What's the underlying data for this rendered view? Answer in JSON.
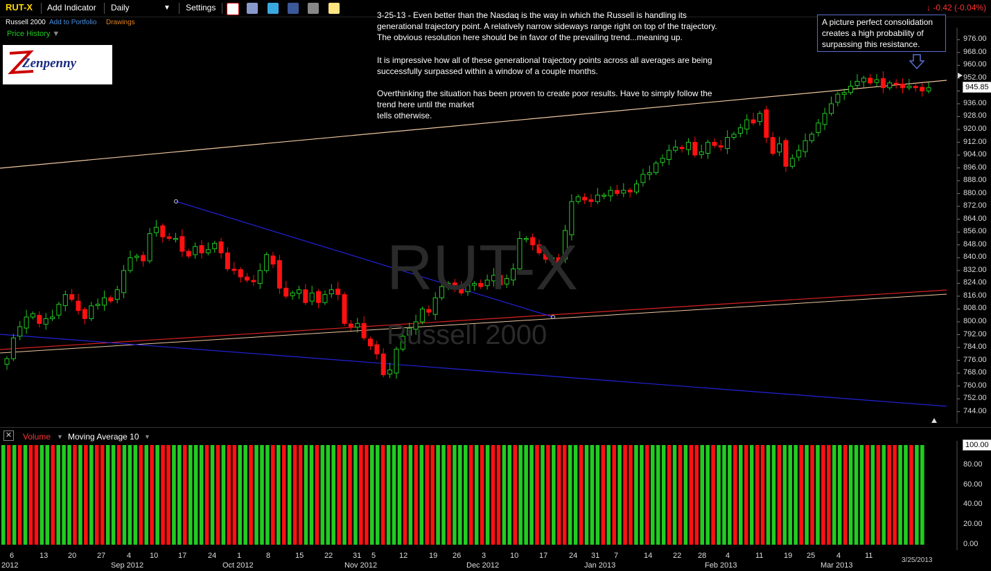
{
  "toolbar": {
    "ticker": "RUT-X",
    "add_indicator": "Add Indicator",
    "period": "Daily",
    "settings": "Settings",
    "change": "-0.42 (-0.04%)",
    "name": "Russell 2000",
    "add_to_portfolio": "Add to Portfolio",
    "drawings": "Drawings",
    "price_history": "Price History"
  },
  "logo": {
    "text": "Zenpenny"
  },
  "watermark": {
    "symbol": "RUT-X",
    "name": "Russell 2000"
  },
  "annotation": {
    "p1": "3-25-13 - Even better than the Nasdaq is the way in which the Russell is handling its\ngenerational trajectory point. A relatively narrow sideways range right on top of the trajectory.\nThe obvious resolution here should be in favor of the prevailing trend...meaning up.",
    "p2": "It is impressive how all of these generational trajectory points across all averages are being\nsuccessfully surpassed within a window of a couple months.",
    "p3": "Overthinking the situation has been proven to create poor results. Have to simply follow the\ntrend here until the market\ntells otherwise."
  },
  "callout": {
    "text": "A picture perfect consolidation\ncreates a high probability of\nsurpassing this resistance."
  },
  "volume_panel": {
    "title": "Volume",
    "overlay": "Moving Average 10",
    "y_ticks": [
      "100.00",
      "80.00",
      "60.00",
      "40.00",
      "20.00",
      "0.00"
    ]
  },
  "date_stamp": "3/25/2013",
  "colors": {
    "up": "#22cc22",
    "down": "#ff1111",
    "background": "#000000",
    "line_blue": "#2222dd",
    "line_red": "#dd2222",
    "line_peach": "#f0c8a0"
  },
  "chart_data": {
    "type": "candlestick",
    "title": "RUT-X Russell 2000",
    "last_price": "945.85",
    "y_ticks": [
      "976.00",
      "968.00",
      "960.00",
      "952.00",
      "944.00",
      "936.00",
      "928.00",
      "920.00",
      "912.00",
      "904.00",
      "896.00",
      "888.00",
      "880.00",
      "872.00",
      "864.00",
      "856.00",
      "848.00",
      "840.00",
      "832.00",
      "824.00",
      "816.00",
      "808.00",
      "800.00",
      "792.00",
      "784.00",
      "776.00",
      "768.00",
      "760.00",
      "752.00",
      "744.00"
    ],
    "ylim": [
      740,
      980
    ],
    "x_day_labels": [
      "6",
      "13",
      "20",
      "27",
      "4",
      "10",
      "17",
      "24",
      "1",
      "8",
      "15",
      "22",
      "31",
      "5",
      "12",
      "19",
      "26",
      "3",
      "10",
      "17",
      "24",
      "31",
      "7",
      "14",
      "22",
      "28",
      "4",
      "11",
      "19",
      "25",
      "4",
      "11"
    ],
    "x_month_labels": [
      "2012",
      "Sep 2012",
      "Oct 2012",
      "Nov 2012",
      "Dec 2012",
      "Jan 2013",
      "Feb 2013",
      "Mar 2013"
    ],
    "closes": [
      777,
      790,
      797,
      803,
      805,
      799,
      802,
      803,
      811,
      817,
      814,
      807,
      802,
      810,
      811,
      815,
      813,
      820,
      832,
      840,
      841,
      838,
      855,
      859,
      853,
      852,
      852,
      844,
      841,
      847,
      843,
      845,
      849,
      843,
      833,
      832,
      828,
      826,
      825,
      832,
      842,
      836,
      821,
      816,
      818,
      820,
      812,
      818,
      812,
      817,
      820,
      817,
      799,
      797,
      799,
      790,
      785,
      780,
      767,
      770,
      783,
      791,
      796,
      800,
      808,
      806,
      815,
      822,
      824,
      822,
      818,
      823,
      824,
      822,
      826,
      829,
      823,
      827,
      833,
      852,
      852,
      848,
      843,
      839,
      840,
      836,
      857,
      875,
      878,
      876,
      875,
      879,
      879,
      882,
      880,
      882,
      881,
      886,
      892,
      893,
      899,
      902,
      907,
      909,
      908,
      912,
      904,
      906,
      912,
      910,
      909,
      915,
      917,
      921,
      926,
      924,
      930,
      915,
      905,
      911,
      897,
      902,
      907,
      913,
      917,
      924,
      930,
      936,
      942,
      943,
      947,
      950,
      952,
      949,
      951,
      946,
      949,
      948,
      946,
      947,
      946,
      944,
      946
    ],
    "ranges": {
      "low": 766,
      "high": 955
    }
  },
  "volume_data": {
    "type": "bar",
    "pattern": "alternating up/down days",
    "ylim": [
      0,
      100
    ]
  }
}
